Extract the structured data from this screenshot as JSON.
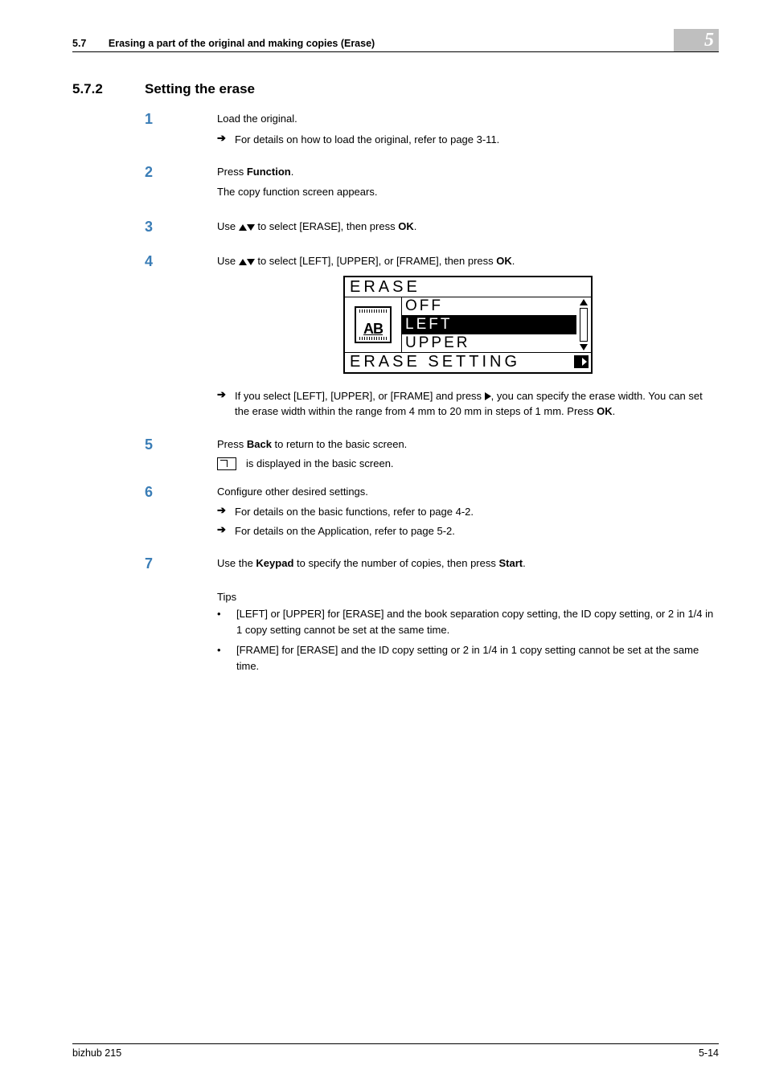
{
  "header": {
    "section_num": "5.7",
    "section_title": "Erasing a part of the original and making copies (Erase)",
    "chapter": "5"
  },
  "title": {
    "num": "5.7.2",
    "text": "Setting the erase"
  },
  "steps": [
    {
      "num": "1",
      "lines": [
        "Load the original."
      ],
      "subs": [
        {
          "text": "For details on how to load the original, refer to page 3-11."
        }
      ]
    },
    {
      "num": "2",
      "parts": [
        {
          "t": "Press "
        },
        {
          "t": "Function",
          "b": true
        },
        {
          "t": "."
        }
      ],
      "lines2": [
        "The copy function screen appears."
      ]
    },
    {
      "num": "3",
      "parts": [
        {
          "t": "Use "
        },
        {
          "tri": "up"
        },
        {
          "tri": "down"
        },
        {
          "t": " to select [ERASE], then press "
        },
        {
          "t": "OK",
          "b": true
        },
        {
          "t": "."
        }
      ]
    },
    {
      "num": "4",
      "parts": [
        {
          "t": "Use "
        },
        {
          "tri": "up"
        },
        {
          "tri": "down"
        },
        {
          "t": " to select [LEFT], [UPPER], or [FRAME], then press "
        },
        {
          "t": "OK",
          "b": true
        },
        {
          "t": "."
        }
      ],
      "lcd": true,
      "subs": [
        {
          "parts": [
            {
              "t": "If you select [LEFT], [UPPER], or [FRAME] and press "
            },
            {
              "tri": "right"
            },
            {
              "t": ", you can specify the erase width. You can set the erase width within the range from 4 mm to 20 mm in steps of 1 mm. Press "
            },
            {
              "t": "OK",
              "b": true
            },
            {
              "t": "."
            }
          ]
        }
      ]
    },
    {
      "num": "5",
      "parts": [
        {
          "t": "Press "
        },
        {
          "t": "Back",
          "b": true
        },
        {
          "t": " to return to the basic screen."
        }
      ],
      "iconline": " is displayed in the basic screen."
    },
    {
      "num": "6",
      "lines": [
        "Configure other desired settings."
      ],
      "subs": [
        {
          "text": "For details on the basic functions, refer to page 4-2."
        },
        {
          "text": "For details on the Application, refer to page 5-2."
        }
      ]
    },
    {
      "num": "7",
      "parts": [
        {
          "t": "Use the "
        },
        {
          "t": "Keypad",
          "b": true
        },
        {
          "t": " to specify the number of copies, then press "
        },
        {
          "t": "Start",
          "b": true
        },
        {
          "t": "."
        }
      ]
    }
  ],
  "lcd": {
    "title": "ERASE",
    "options": [
      "OFF",
      "LEFT",
      "UPPER"
    ],
    "selected": 1,
    "icon_letters": "AB",
    "footer": "ERASE SETTING"
  },
  "tips_label": "Tips",
  "tips": [
    "[LEFT] or [UPPER] for [ERASE] and the book separation copy setting, the ID copy setting, or 2 in 1/4 in 1 copy setting cannot be set at the same time.",
    "[FRAME] for [ERASE] and the ID copy setting or 2 in 1/4 in 1 copy setting cannot be set at the same time."
  ],
  "footer": {
    "product": "bizhub 215",
    "page": "5-14"
  }
}
